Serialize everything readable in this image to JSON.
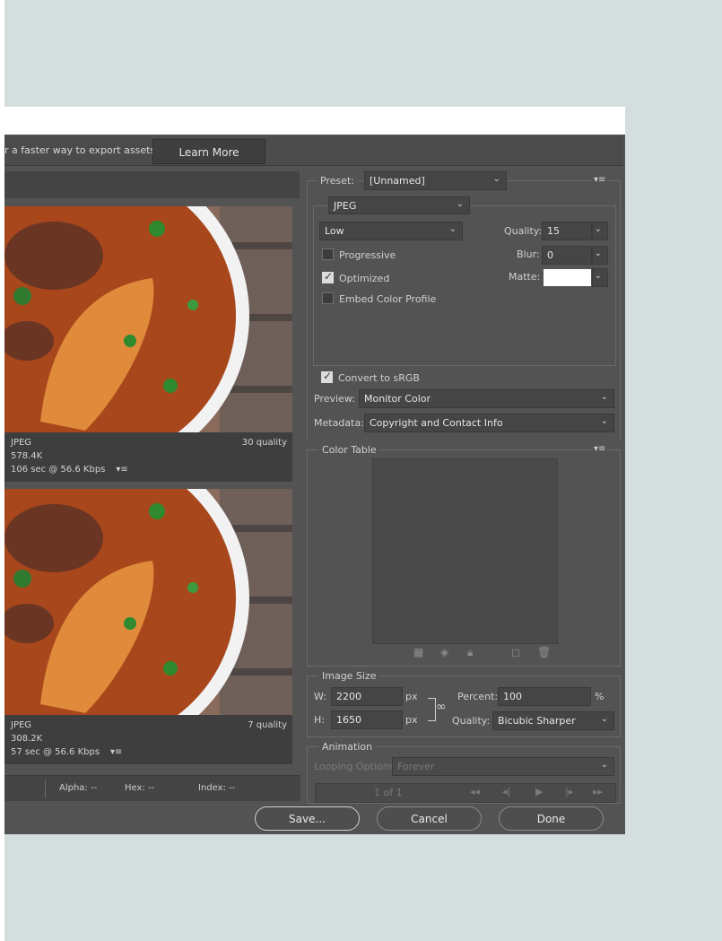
{
  "promo": {
    "text": "r a faster way to export assets",
    "learn_more": "Learn More"
  },
  "preview1": {
    "format": "JPEG",
    "quality": "30 quality",
    "size": "578.4K",
    "time": "106 sec @ 56.6 Kbps"
  },
  "preview2": {
    "format": "JPEG",
    "quality": "7 quality",
    "size": "308.2K",
    "time": "57 sec @ 56.6 Kbps"
  },
  "status": {
    "alpha": "Alpha: --",
    "hex": "Hex: --",
    "index": "Index: --"
  },
  "settings": {
    "preset_label": "Preset:",
    "preset_value": "[Unnamed]",
    "format": "JPEG",
    "compression": "Low",
    "quality_label": "Quality:",
    "quality_value": "15",
    "progressive": "Progressive",
    "progressive_checked": false,
    "blur_label": "Blur:",
    "blur_value": "0",
    "optimized": "Optimized",
    "optimized_checked": true,
    "matte_label": "Matte:",
    "embed_color_profile": "Embed Color Profile",
    "embed_checked": false,
    "convert_srgb": "Convert to sRGB",
    "convert_checked": true,
    "preview_label": "Preview:",
    "preview_value": "Monitor Color",
    "metadata_label": "Metadata:",
    "metadata_value": "Copyright and Contact Info"
  },
  "color_table": {
    "title": "Color Table"
  },
  "image_size": {
    "title": "Image Size",
    "w_label": "W:",
    "w_value": "2200",
    "h_label": "H:",
    "h_value": "1650",
    "px": "px",
    "percent_label": "Percent:",
    "percent_value": "100",
    "percent_unit": "%",
    "quality_label": "Quality:",
    "quality_value": "Bicubic Sharper"
  },
  "animation": {
    "title": "Animation",
    "looping_label": "Looping Options:",
    "looping_value": "Forever",
    "frame": "1 of 1"
  },
  "buttons": {
    "save": "Save...",
    "cancel": "Cancel",
    "done": "Done"
  },
  "colors": {
    "dialog_bg": "#535353",
    "page_bg": "#d5dedf",
    "field_bg": "#454545"
  }
}
